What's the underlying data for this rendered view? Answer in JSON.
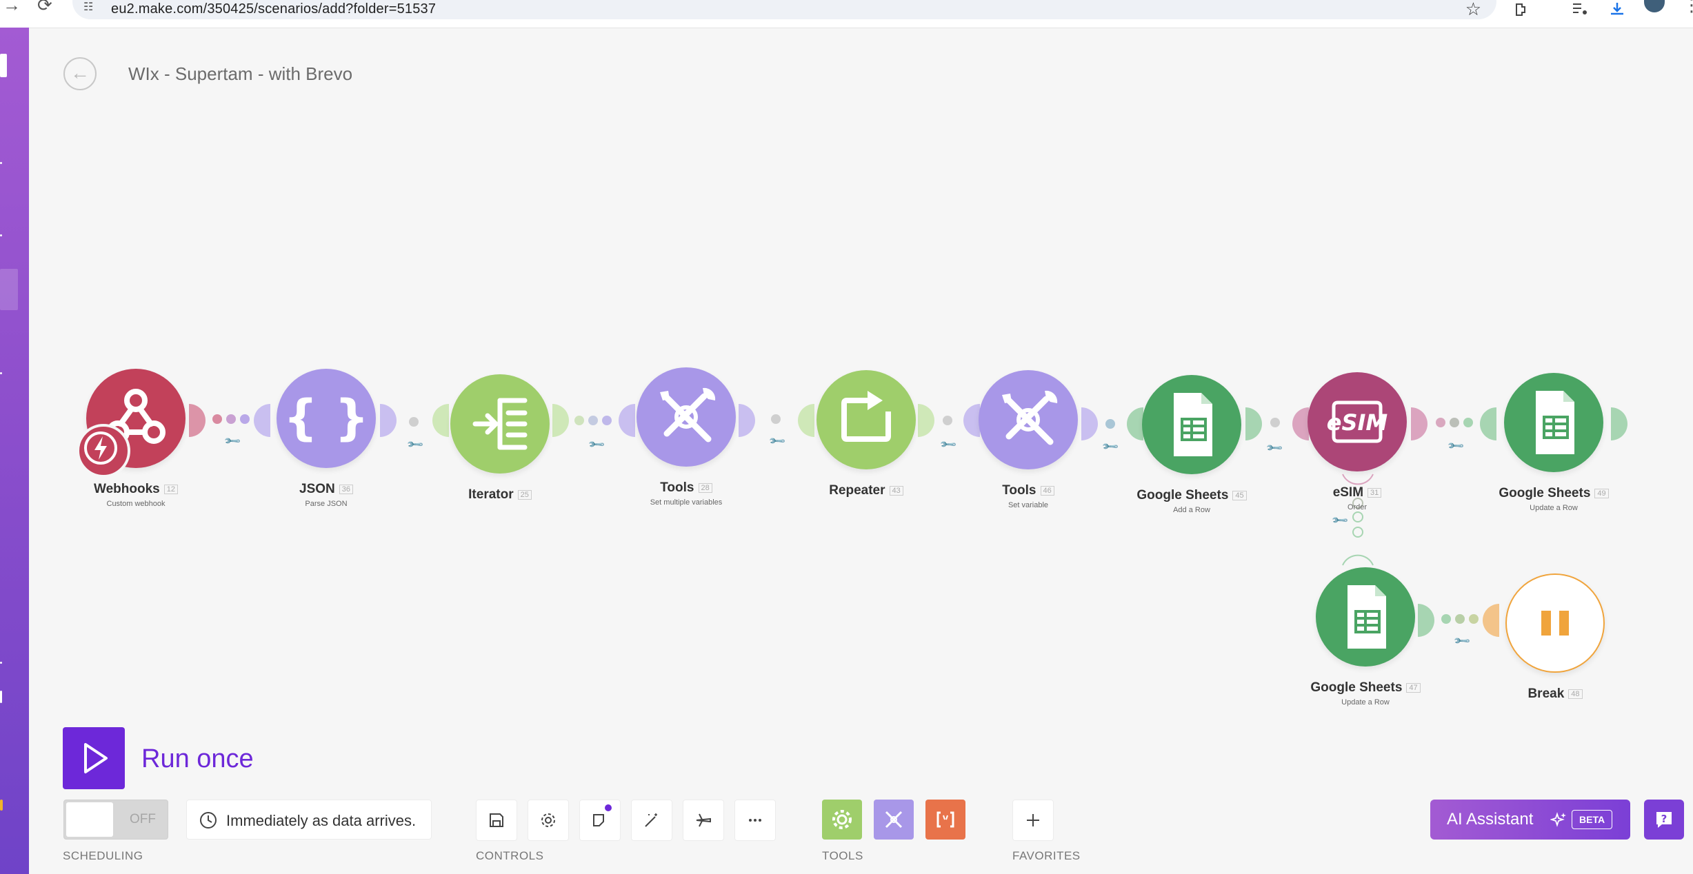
{
  "browser": {
    "url": "eu2.make.com/350425/scenarios/add?folder=51537"
  },
  "scenario": {
    "title": "WIx - Supertam - with Brevo"
  },
  "modules": {
    "webhooks": {
      "name": "Webhooks",
      "id": "12",
      "sub": "Custom webhook",
      "color": "#c2415a"
    },
    "json": {
      "name": "JSON",
      "id": "36",
      "sub": "Parse JSON",
      "color": "#a897e8"
    },
    "iterator": {
      "name": "Iterator",
      "id": "25",
      "sub": "",
      "color": "#9fce6b"
    },
    "tools28": {
      "name": "Tools",
      "id": "28",
      "sub": "Set multiple variables",
      "color": "#a897e8"
    },
    "repeater": {
      "name": "Repeater",
      "id": "43",
      "sub": "",
      "color": "#9fce6b"
    },
    "tools46": {
      "name": "Tools",
      "id": "46",
      "sub": "Set variable",
      "color": "#a897e8"
    },
    "sheets45": {
      "name": "Google Sheets",
      "id": "45",
      "sub": "Add a Row",
      "color": "#4aa463"
    },
    "esim": {
      "name": "eSIM",
      "id": "31",
      "sub": "Order",
      "color": "#ac4677"
    },
    "sheets49": {
      "name": "Google Sheets",
      "id": "49",
      "sub": "Update a Row",
      "color": "#4aa463"
    },
    "sheets47": {
      "name": "Google Sheets",
      "id": "47",
      "sub": "Update a Row",
      "color": "#4aa463"
    },
    "break": {
      "name": "Break",
      "id": "48",
      "sub": "",
      "color": "#f0a43c"
    }
  },
  "toolbar": {
    "run_label": "Run once",
    "toggle_label": "OFF",
    "schedule_text": "Immediately as data arrives.",
    "scheduling_label": "SCHEDULING",
    "controls_label": "CONTROLS",
    "tools_label": "TOOLS",
    "favorites_label": "FAVORITES",
    "ai_label": "AI Assistant",
    "beta_label": "BETA"
  },
  "icons": {
    "esim_text": "eSIM"
  }
}
